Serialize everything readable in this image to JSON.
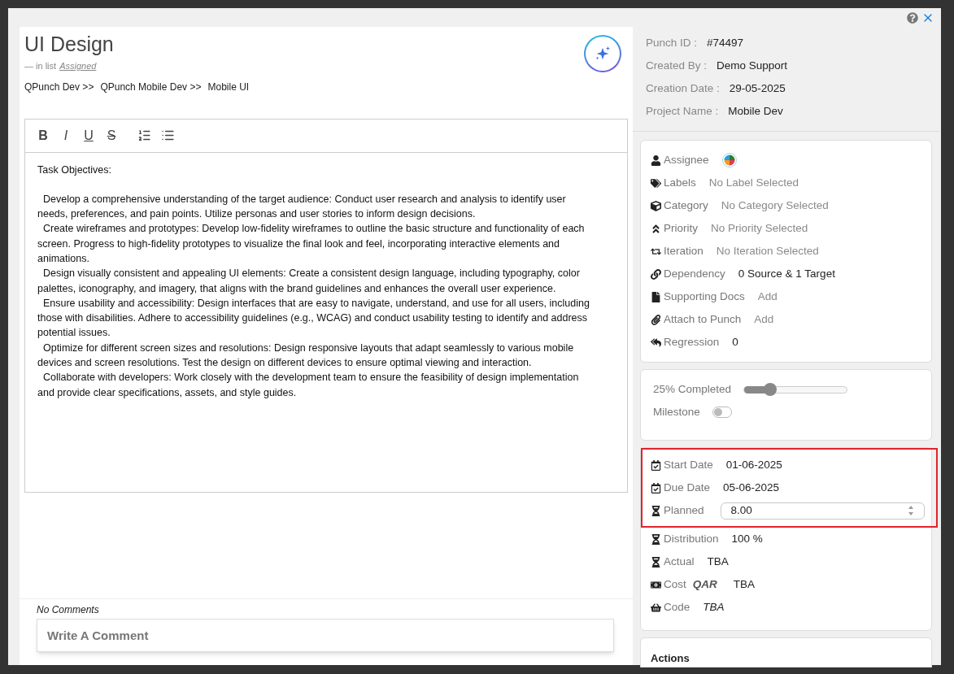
{
  "dialog": {
    "title": "UI Design",
    "list_prefix": "— in list",
    "list_name": "Assigned",
    "breadcrumb": [
      "QPunch Dev >>",
      "QPunch Mobile Dev >>",
      "Mobile UI"
    ],
    "editor": {
      "toolbar": [
        "B",
        "I",
        "U",
        "S"
      ],
      "paragraphs": [
        "Task Objectives:",
        "  Develop a comprehensive understanding of the target audience: Conduct user research and analysis to identify user needs, preferences, and pain points. Utilize personas and user stories to inform design decisions.",
        "  Create wireframes and prototypes: Develop low-fidelity wireframes to outline the basic structure and functionality of each screen. Progress to high-fidelity prototypes to visualize the final look and feel, incorporating interactive elements and animations.",
        "  Design visually consistent and appealing UI elements: Create a consistent design language, including typography, color palettes, iconography, and imagery, that aligns with the brand guidelines and enhances the overall user experience.",
        "  Ensure usability and accessibility: Design interfaces that are easy to navigate, understand, and use for all users, including those with disabilities. Adhere to accessibility guidelines (e.g., WCAG) and conduct usability testing to identify and address potential issues.",
        "  Optimize for different screen sizes and resolutions: Design responsive layouts that adapt seamlessly to various mobile devices and screen resolutions. Test the design on different devices to ensure optimal viewing and interaction.",
        "  Collaborate with developers: Work closely with the development team to ensure the feasibility of design implementation and provide clear specifications, assets, and style guides."
      ]
    },
    "comments": {
      "status": "No Comments",
      "placeholder": "Write A Comment"
    },
    "info": [
      {
        "label": "Punch ID :",
        "value": "#74497"
      },
      {
        "label": "Created By :",
        "value": "Demo Support"
      },
      {
        "label": "Creation Date :",
        "value": "29-05-2025"
      },
      {
        "label": "Project Name :",
        "value": "Mobile Dev"
      }
    ],
    "details": [
      {
        "kind": "avatar",
        "label": "Assignee"
      },
      {
        "kind": "text",
        "label": "Labels",
        "value": "No Label Selected",
        "muted": true
      },
      {
        "kind": "text",
        "label": "Category",
        "value": "No Category Selected",
        "muted": true
      },
      {
        "kind": "text",
        "label": "Priority",
        "value": "No Priority Selected",
        "muted": true
      },
      {
        "kind": "text",
        "label": "Iteration",
        "value": "No Iteration Selected",
        "muted": true
      },
      {
        "kind": "text",
        "label": "Dependency",
        "value": "0 Source & 1 Target",
        "muted": false
      },
      {
        "kind": "text",
        "label": "Supporting Docs",
        "value": "Add",
        "muted": true
      },
      {
        "kind": "text",
        "label": "Attach to Punch",
        "value": "Add",
        "muted": true
      },
      {
        "kind": "text",
        "label": "Regression",
        "value": "0",
        "muted": false
      }
    ],
    "progress": {
      "label": "25% Completed",
      "level": 0.25
    },
    "milestone": {
      "label": "Milestone",
      "on": false
    },
    "schedule_highlighted": [
      {
        "kind": "text",
        "label": "Start Date",
        "value": "01-06-2025"
      },
      {
        "kind": "text",
        "label": "Due Date",
        "value": "05-06-2025"
      },
      {
        "kind": "input",
        "label": "Planned",
        "value": "8.00"
      }
    ],
    "schedule": [
      {
        "kind": "text",
        "label": "Distribution",
        "value": "100 %"
      },
      {
        "kind": "text",
        "label": "Actual",
        "value": "TBA"
      },
      {
        "kind": "currency",
        "label": "Cost",
        "currency": "QAR",
        "value": "TBA"
      },
      {
        "kind": "italic",
        "label": "Code",
        "value": "TBA"
      }
    ],
    "actions": {
      "title": "Actions"
    }
  }
}
